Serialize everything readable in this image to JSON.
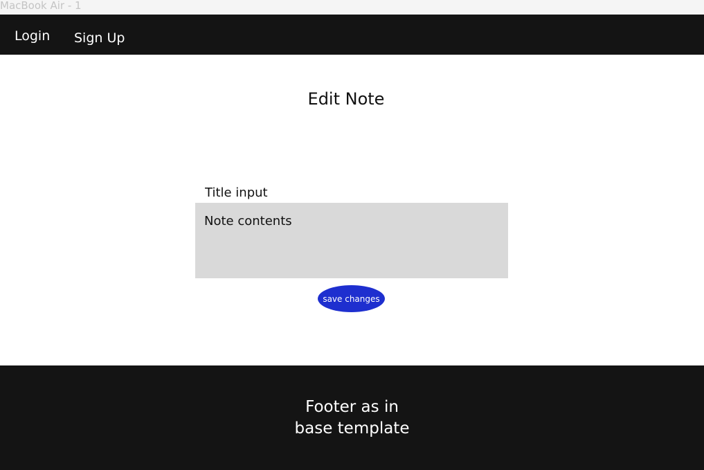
{
  "window": {
    "frame_label": "MacBook Air - 1"
  },
  "nav": {
    "login_label": "Login",
    "signup_label": "Sign Up"
  },
  "main": {
    "page_title": "Edit Note",
    "title_input_placeholder": "Title input",
    "note_contents_placeholder": "Note contents",
    "save_label": "save changes"
  },
  "footer": {
    "line1": "Footer as in",
    "line2": "base template"
  },
  "colors": {
    "nav_background": "#141414",
    "footer_background": "#141414",
    "accent_button": "#1e2fcf",
    "textarea_background": "#d9d9d9"
  }
}
